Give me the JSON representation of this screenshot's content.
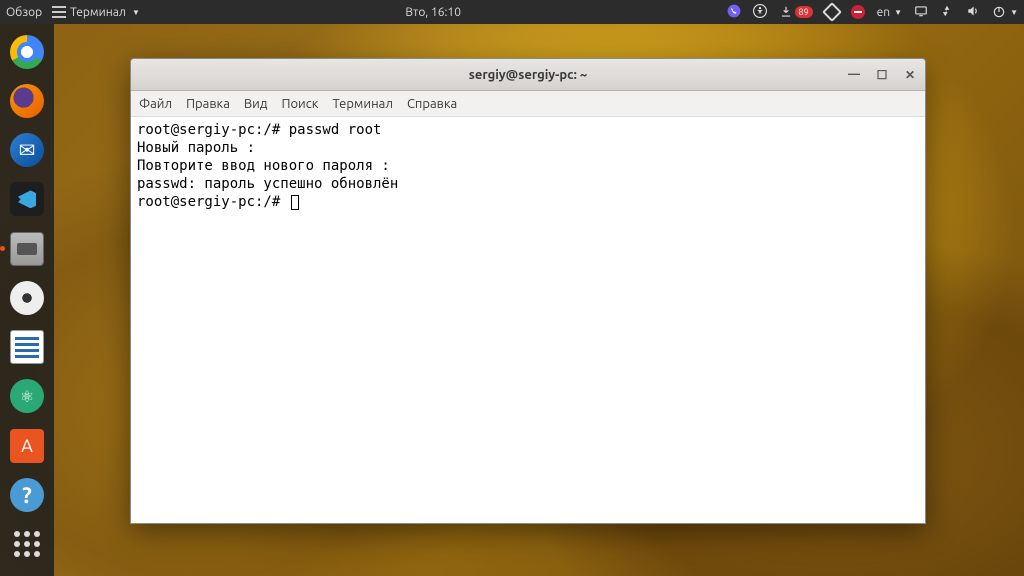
{
  "topbar": {
    "activities": "Обзор",
    "app_label": "Терминал",
    "clock": "Вто, 16:10",
    "lang": "en",
    "update_count": "89"
  },
  "window": {
    "title": "sergiy@sergiy-pc: ~",
    "menu": {
      "file": "Файл",
      "edit": "Правка",
      "view": "Вид",
      "search": "Поиск",
      "terminal": "Терминал",
      "help": "Справка"
    }
  },
  "terminal": {
    "line1": "root@sergiy-pc:/# passwd root",
    "line2": "Новый пароль :",
    "line3": "Повторите ввод нового пароля :",
    "line4": "passwd: пароль успешно обновлён",
    "line5": "root@sergiy-pc:/# "
  }
}
